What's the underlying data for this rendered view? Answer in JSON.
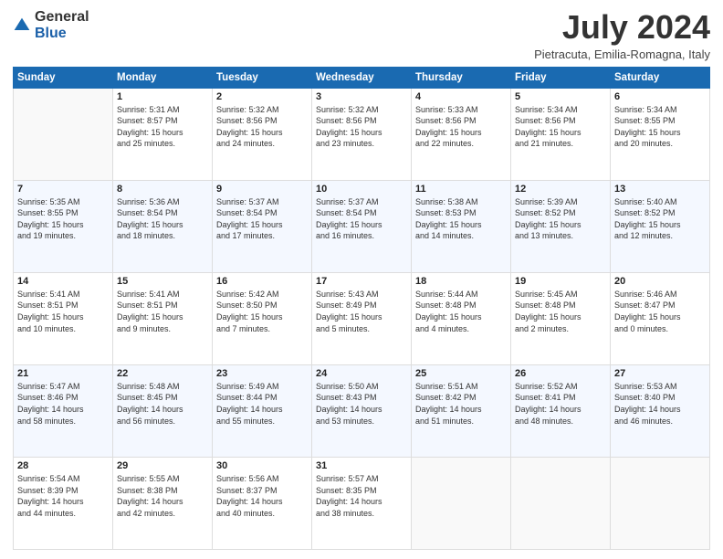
{
  "header": {
    "logo_general": "General",
    "logo_blue": "Blue",
    "month_title": "July 2024",
    "location": "Pietracuta, Emilia-Romagna, Italy"
  },
  "weekdays": [
    "Sunday",
    "Monday",
    "Tuesday",
    "Wednesday",
    "Thursday",
    "Friday",
    "Saturday"
  ],
  "weeks": [
    [
      {
        "day": "",
        "info": ""
      },
      {
        "day": "1",
        "info": "Sunrise: 5:31 AM\nSunset: 8:57 PM\nDaylight: 15 hours\nand 25 minutes."
      },
      {
        "day": "2",
        "info": "Sunrise: 5:32 AM\nSunset: 8:56 PM\nDaylight: 15 hours\nand 24 minutes."
      },
      {
        "day": "3",
        "info": "Sunrise: 5:32 AM\nSunset: 8:56 PM\nDaylight: 15 hours\nand 23 minutes."
      },
      {
        "day": "4",
        "info": "Sunrise: 5:33 AM\nSunset: 8:56 PM\nDaylight: 15 hours\nand 22 minutes."
      },
      {
        "day": "5",
        "info": "Sunrise: 5:34 AM\nSunset: 8:56 PM\nDaylight: 15 hours\nand 21 minutes."
      },
      {
        "day": "6",
        "info": "Sunrise: 5:34 AM\nSunset: 8:55 PM\nDaylight: 15 hours\nand 20 minutes."
      }
    ],
    [
      {
        "day": "7",
        "info": "Sunrise: 5:35 AM\nSunset: 8:55 PM\nDaylight: 15 hours\nand 19 minutes."
      },
      {
        "day": "8",
        "info": "Sunrise: 5:36 AM\nSunset: 8:54 PM\nDaylight: 15 hours\nand 18 minutes."
      },
      {
        "day": "9",
        "info": "Sunrise: 5:37 AM\nSunset: 8:54 PM\nDaylight: 15 hours\nand 17 minutes."
      },
      {
        "day": "10",
        "info": "Sunrise: 5:37 AM\nSunset: 8:54 PM\nDaylight: 15 hours\nand 16 minutes."
      },
      {
        "day": "11",
        "info": "Sunrise: 5:38 AM\nSunset: 8:53 PM\nDaylight: 15 hours\nand 14 minutes."
      },
      {
        "day": "12",
        "info": "Sunrise: 5:39 AM\nSunset: 8:52 PM\nDaylight: 15 hours\nand 13 minutes."
      },
      {
        "day": "13",
        "info": "Sunrise: 5:40 AM\nSunset: 8:52 PM\nDaylight: 15 hours\nand 12 minutes."
      }
    ],
    [
      {
        "day": "14",
        "info": "Sunrise: 5:41 AM\nSunset: 8:51 PM\nDaylight: 15 hours\nand 10 minutes."
      },
      {
        "day": "15",
        "info": "Sunrise: 5:41 AM\nSunset: 8:51 PM\nDaylight: 15 hours\nand 9 minutes."
      },
      {
        "day": "16",
        "info": "Sunrise: 5:42 AM\nSunset: 8:50 PM\nDaylight: 15 hours\nand 7 minutes."
      },
      {
        "day": "17",
        "info": "Sunrise: 5:43 AM\nSunset: 8:49 PM\nDaylight: 15 hours\nand 5 minutes."
      },
      {
        "day": "18",
        "info": "Sunrise: 5:44 AM\nSunset: 8:48 PM\nDaylight: 15 hours\nand 4 minutes."
      },
      {
        "day": "19",
        "info": "Sunrise: 5:45 AM\nSunset: 8:48 PM\nDaylight: 15 hours\nand 2 minutes."
      },
      {
        "day": "20",
        "info": "Sunrise: 5:46 AM\nSunset: 8:47 PM\nDaylight: 15 hours\nand 0 minutes."
      }
    ],
    [
      {
        "day": "21",
        "info": "Sunrise: 5:47 AM\nSunset: 8:46 PM\nDaylight: 14 hours\nand 58 minutes."
      },
      {
        "day": "22",
        "info": "Sunrise: 5:48 AM\nSunset: 8:45 PM\nDaylight: 14 hours\nand 56 minutes."
      },
      {
        "day": "23",
        "info": "Sunrise: 5:49 AM\nSunset: 8:44 PM\nDaylight: 14 hours\nand 55 minutes."
      },
      {
        "day": "24",
        "info": "Sunrise: 5:50 AM\nSunset: 8:43 PM\nDaylight: 14 hours\nand 53 minutes."
      },
      {
        "day": "25",
        "info": "Sunrise: 5:51 AM\nSunset: 8:42 PM\nDaylight: 14 hours\nand 51 minutes."
      },
      {
        "day": "26",
        "info": "Sunrise: 5:52 AM\nSunset: 8:41 PM\nDaylight: 14 hours\nand 48 minutes."
      },
      {
        "day": "27",
        "info": "Sunrise: 5:53 AM\nSunset: 8:40 PM\nDaylight: 14 hours\nand 46 minutes."
      }
    ],
    [
      {
        "day": "28",
        "info": "Sunrise: 5:54 AM\nSunset: 8:39 PM\nDaylight: 14 hours\nand 44 minutes."
      },
      {
        "day": "29",
        "info": "Sunrise: 5:55 AM\nSunset: 8:38 PM\nDaylight: 14 hours\nand 42 minutes."
      },
      {
        "day": "30",
        "info": "Sunrise: 5:56 AM\nSunset: 8:37 PM\nDaylight: 14 hours\nand 40 minutes."
      },
      {
        "day": "31",
        "info": "Sunrise: 5:57 AM\nSunset: 8:35 PM\nDaylight: 14 hours\nand 38 minutes."
      },
      {
        "day": "",
        "info": ""
      },
      {
        "day": "",
        "info": ""
      },
      {
        "day": "",
        "info": ""
      }
    ]
  ]
}
